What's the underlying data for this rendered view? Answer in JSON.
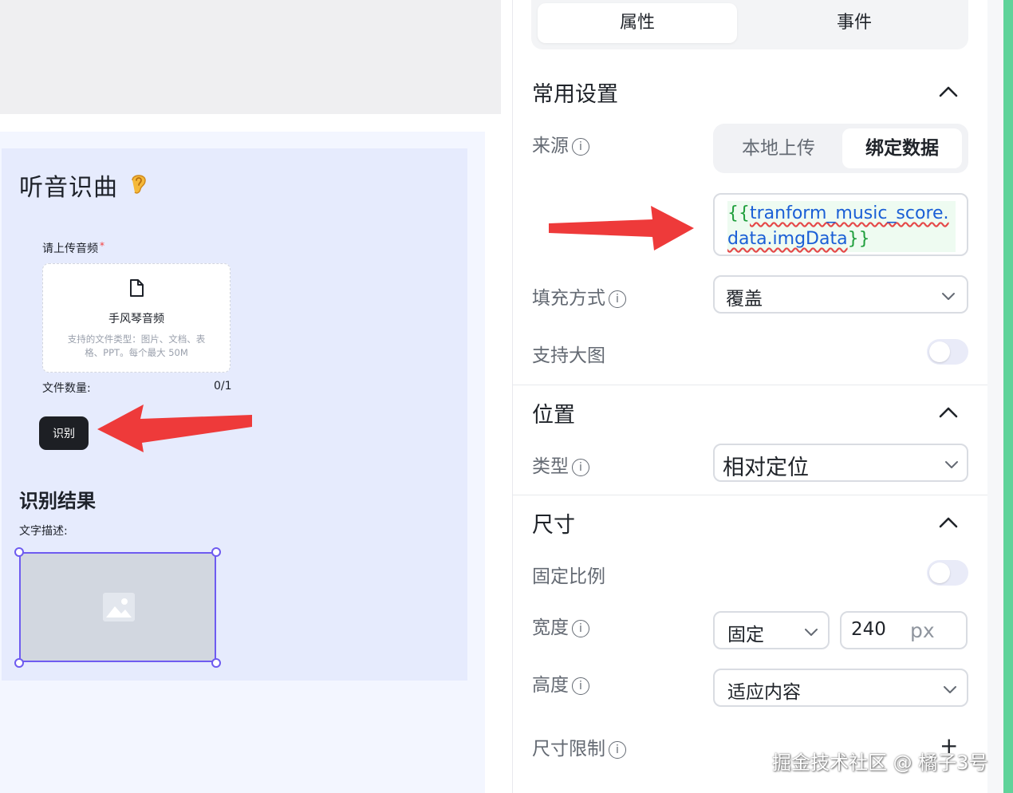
{
  "canvas": {
    "title": "听音识曲",
    "upload": {
      "label": "请上传音频",
      "required_mark": "*",
      "dropzone_title": "手风琴音频",
      "dropzone_desc": "支持的文件类型：图片、文档、表格、PPT。每个最大 50M"
    },
    "file_count": {
      "label": "文件数量:",
      "value": "0/1"
    },
    "recognize_button": "识别",
    "result_title": "识别结果",
    "desc_label": "文字描述:"
  },
  "panel": {
    "tabs": [
      {
        "label": "属性",
        "active": true
      },
      {
        "label": "事件",
        "active": false
      }
    ],
    "sections": {
      "common": {
        "title": "常用设置",
        "source": {
          "label": "来源",
          "options": [
            {
              "label": "本地上传",
              "selected": false
            },
            {
              "label": "绑定数据",
              "selected": true
            }
          ]
        },
        "binding": {
          "open": "{{",
          "expr": "tranform_music_score.data.imgData",
          "close": "}}"
        },
        "fill_mode": {
          "label": "填充方式",
          "value": "覆盖"
        },
        "large_image": {
          "label": "支持大图",
          "enabled": false
        }
      },
      "position": {
        "title": "位置",
        "type": {
          "label": "类型",
          "value": "相对定位"
        }
      },
      "size": {
        "title": "尺寸",
        "fixed_ratio": {
          "label": "固定比例",
          "enabled": false
        },
        "width": {
          "label": "宽度",
          "mode": "固定",
          "value": "240",
          "unit": "px"
        },
        "height": {
          "label": "高度",
          "mode": "适应内容"
        },
        "limit": {
          "label": "尺寸限制",
          "add": "+"
        }
      }
    }
  },
  "watermark": "掘金技术社区 @ 橘子3号",
  "colors": {
    "accent_purple": "#6e5bf0",
    "arrow_red": "#ee3a3a",
    "green_strip": "#5fd39a",
    "button_dark": "#1d1f24"
  }
}
